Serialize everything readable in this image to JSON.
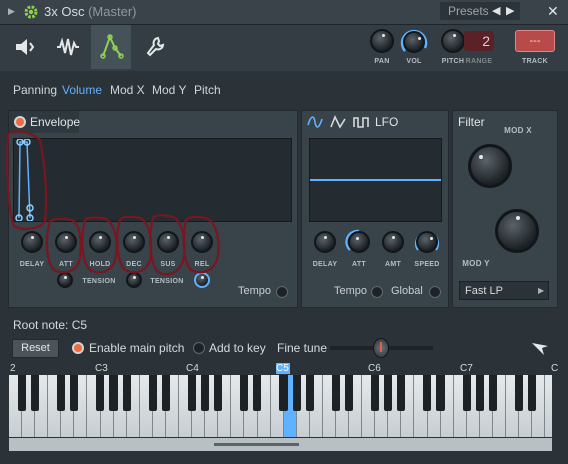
{
  "window": {
    "title": "3x Osc",
    "subtitle": "(Master)",
    "presets_label": "Presets",
    "close": "✕"
  },
  "toolbar": {
    "knobs": [
      {
        "label": "PAN"
      },
      {
        "label": "VOL"
      },
      {
        "label": "PITCH"
      },
      {
        "label": "RANGE"
      }
    ],
    "range_value": "2",
    "track_value": "---",
    "track_label": "TRACK"
  },
  "tabs": [
    "Panning",
    "Volume",
    "Mod X",
    "Mod Y",
    "Pitch"
  ],
  "active_tab": "Volume",
  "envelope": {
    "title": "Envelope",
    "knob_labels": [
      "DELAY",
      "ATT",
      "HOLD",
      "DEC",
      "SUS",
      "REL"
    ],
    "tension_labels": [
      "TENSION",
      "TENSION"
    ],
    "tempo_label": "Tempo"
  },
  "lfo": {
    "title": "LFO",
    "knob_labels": [
      "DELAY",
      "ATT",
      "AMT",
      "SPEED"
    ],
    "tempo_label": "Tempo",
    "global_label": "Global"
  },
  "filter": {
    "title": "Filter",
    "mod_x_label": "MOD X",
    "mod_y_label": "MOD Y",
    "type": "Fast LP"
  },
  "root": {
    "label": "Root note: C5",
    "reset": "Reset",
    "enable_main_pitch": "Enable main pitch",
    "add_to_key": "Add to key",
    "fine_tune": "Fine tune"
  },
  "keyboard": {
    "octave_labels": [
      "2",
      "C3",
      "C4",
      "C5",
      "C6",
      "C7",
      "C"
    ],
    "highlight": "C5"
  },
  "colors": {
    "accent": "#5fb2ff",
    "toggle_on": "#f06a3d",
    "annotation": "#7a1620",
    "track": "#b84a4a"
  }
}
